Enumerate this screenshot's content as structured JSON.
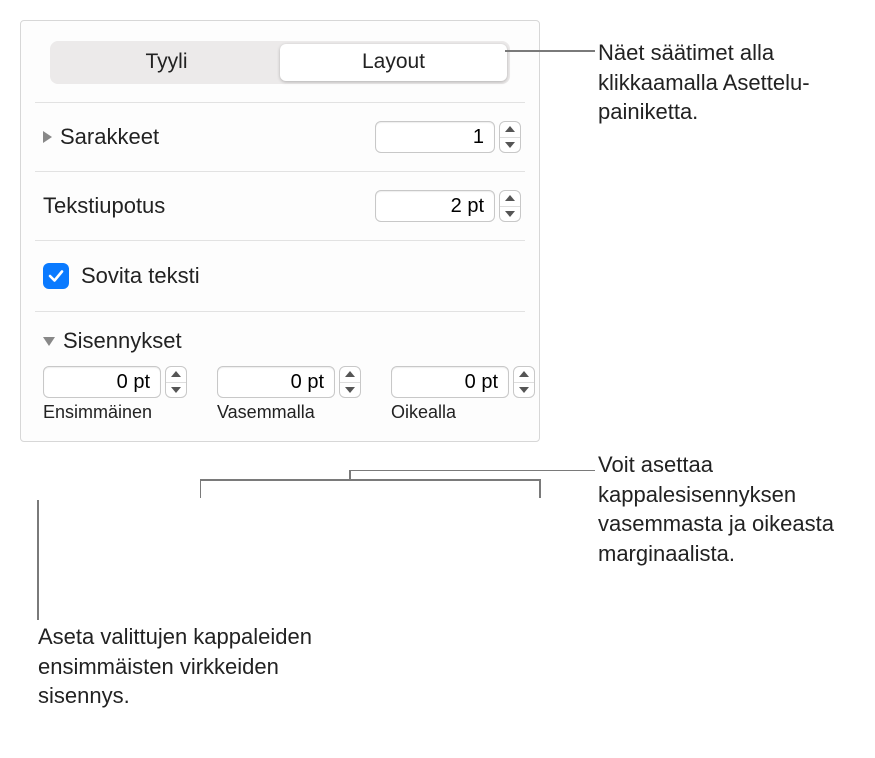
{
  "tabs": {
    "style": "Tyyli",
    "layout": "Layout"
  },
  "columns": {
    "label": "Sarakkeet",
    "value": "1"
  },
  "inset": {
    "label": "Tekstiupotus",
    "value": "2 pt"
  },
  "fit": {
    "label": "Sovita teksti",
    "checked": true
  },
  "indents": {
    "heading": "Sisennykset",
    "first": {
      "value": "0 pt",
      "label": "Ensimmäinen"
    },
    "left": {
      "value": "0 pt",
      "label": "Vasemmalla"
    },
    "right": {
      "value": "0 pt",
      "label": "Oikealla"
    }
  },
  "callouts": {
    "layout_hint": "Näet säätimet alla klikkaamalla Asettelu-painiketta.",
    "margin_hint": "Voit asettaa kappalesisennykse​n vasemmasta ja oikeasta marginaalista.",
    "first_hint": "Aseta valittujen kappaleiden ensimmäisten virkkeiden sisennys."
  }
}
